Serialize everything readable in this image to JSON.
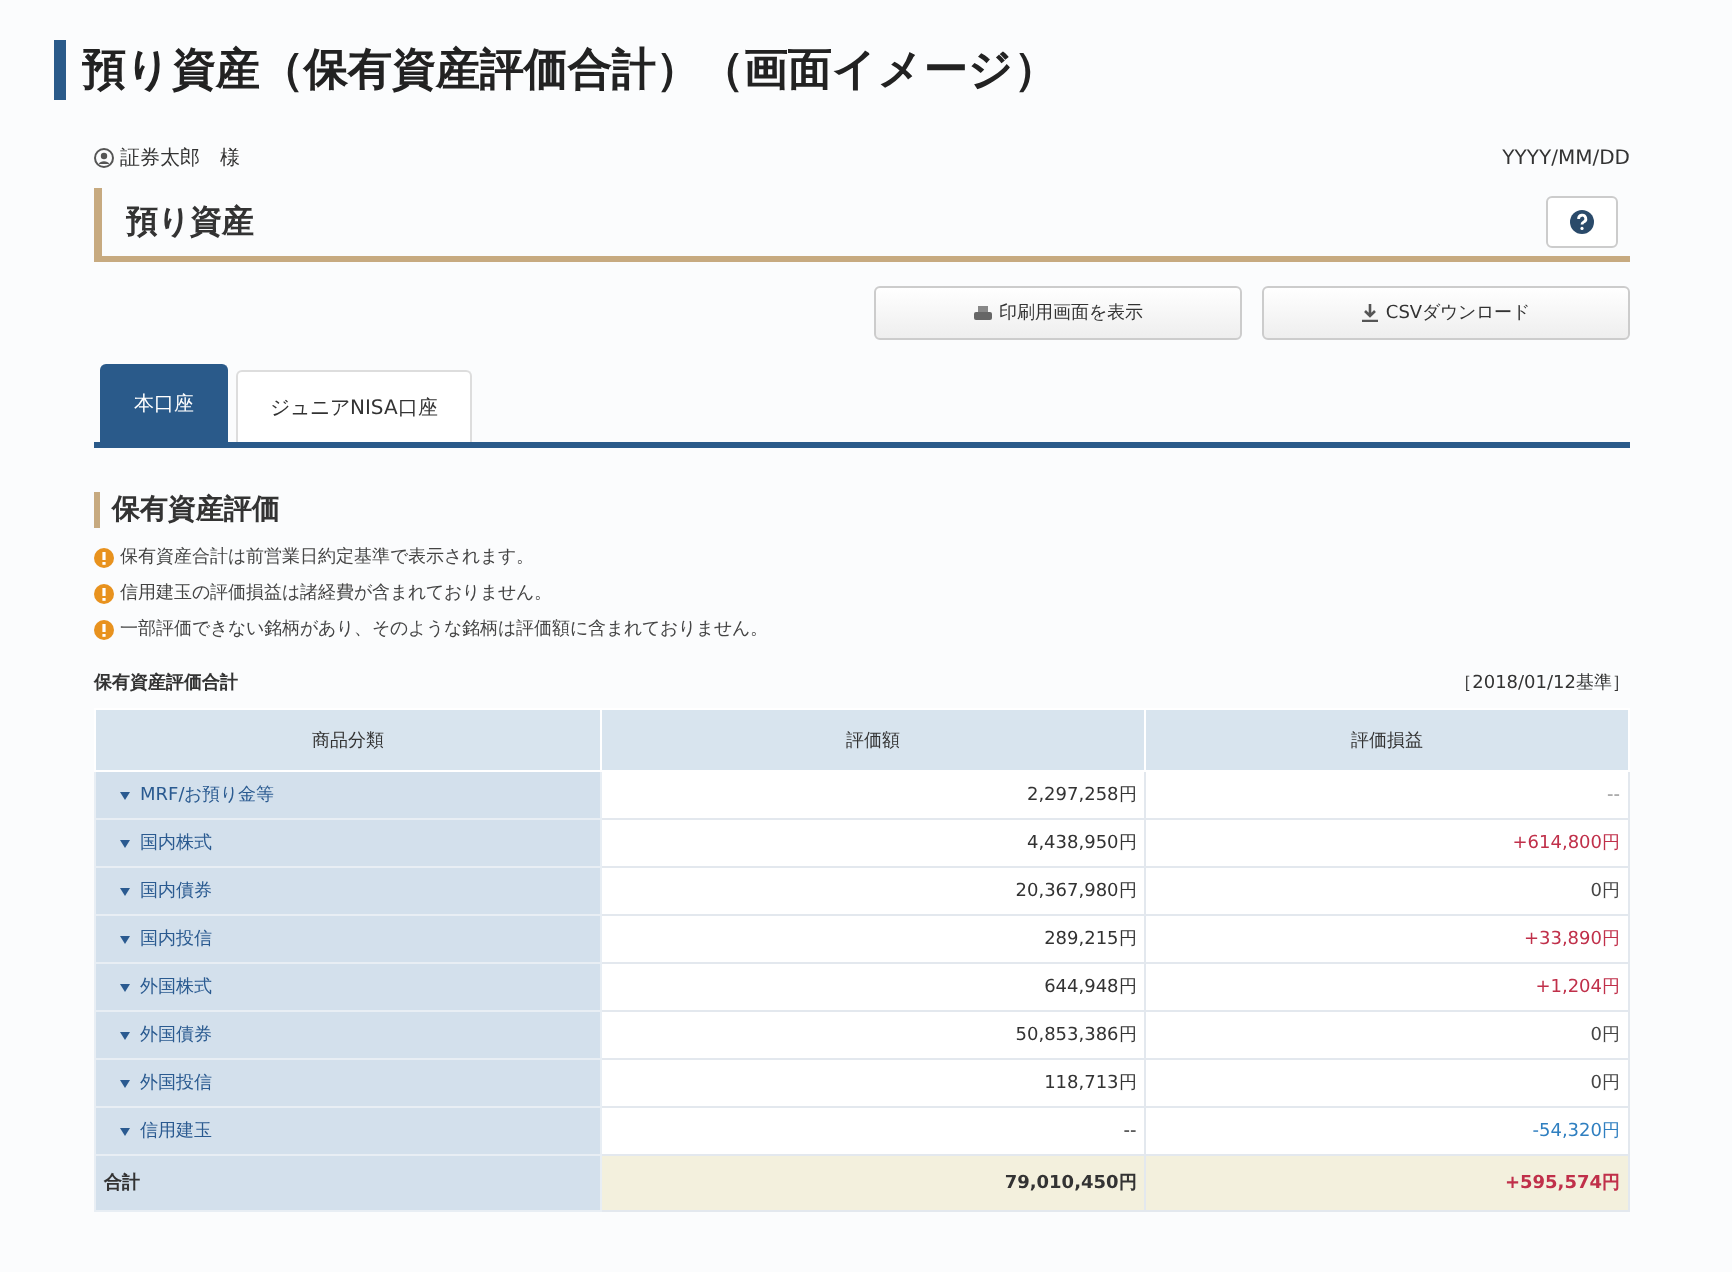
{
  "page_title": "預り資産（保有資産評価合計）（画面イメージ）",
  "user": {
    "name": "証券太郎　様",
    "date": "YYYY/MM/DD"
  },
  "header": {
    "title": "預り資産"
  },
  "buttons": [
    {
      "label": "印刷用画面を表示",
      "kind": "print"
    },
    {
      "label": "CSVダウンロード",
      "kind": "download"
    }
  ],
  "tabs": [
    {
      "label": "本口座",
      "selected": true
    },
    {
      "label": "ジュニアNISA口座",
      "selected": false
    }
  ],
  "section": {
    "title": "保有資産評価",
    "notes": [
      "保有資産合計は前営業日約定基準で表示されます。",
      "信用建玉の評価損益は諸経費が含まれておりません。",
      "一部評価できない銘柄があり、そのような銘柄は評価額に含まれておりません。"
    ]
  },
  "table": {
    "title": "保有資産評価合計",
    "basis": "［2018/01/12基準］",
    "columns": [
      "商品分類",
      "評価額",
      "評価損益"
    ],
    "rows": [
      {
        "category": "MRF/お預り金等",
        "value": "2,297,258円",
        "gain": "--"
      },
      {
        "category": "国内株式",
        "value": "4,438,950円",
        "gain": "+614,800円",
        "color": "#c0304a"
      },
      {
        "category": "国内債券",
        "value": "20,367,980円",
        "gain": "0円",
        "color": "#444444"
      },
      {
        "category": "国内投信",
        "value": "289,215円",
        "gain": "+33,890円",
        "color": "#c0304a"
      },
      {
        "category": "外国株式",
        "value": "644,948円",
        "gain": "+1,204円",
        "color": "#c0304a"
      },
      {
        "category": "外国債券",
        "value": "50,853,386円",
        "gain": "0円",
        "color": "#444444"
      },
      {
        "category": "外国投信",
        "value": "118,713円",
        "gain": "0円",
        "color": "#444444"
      },
      {
        "category": "信用建玉",
        "value": "--",
        "gain": "-54,320円",
        "color": "#2f7fc0"
      }
    ],
    "total": {
      "label": "合計",
      "value": "79,010,450円",
      "gain": "+595,574円",
      "color": "#c0304a"
    }
  }
}
